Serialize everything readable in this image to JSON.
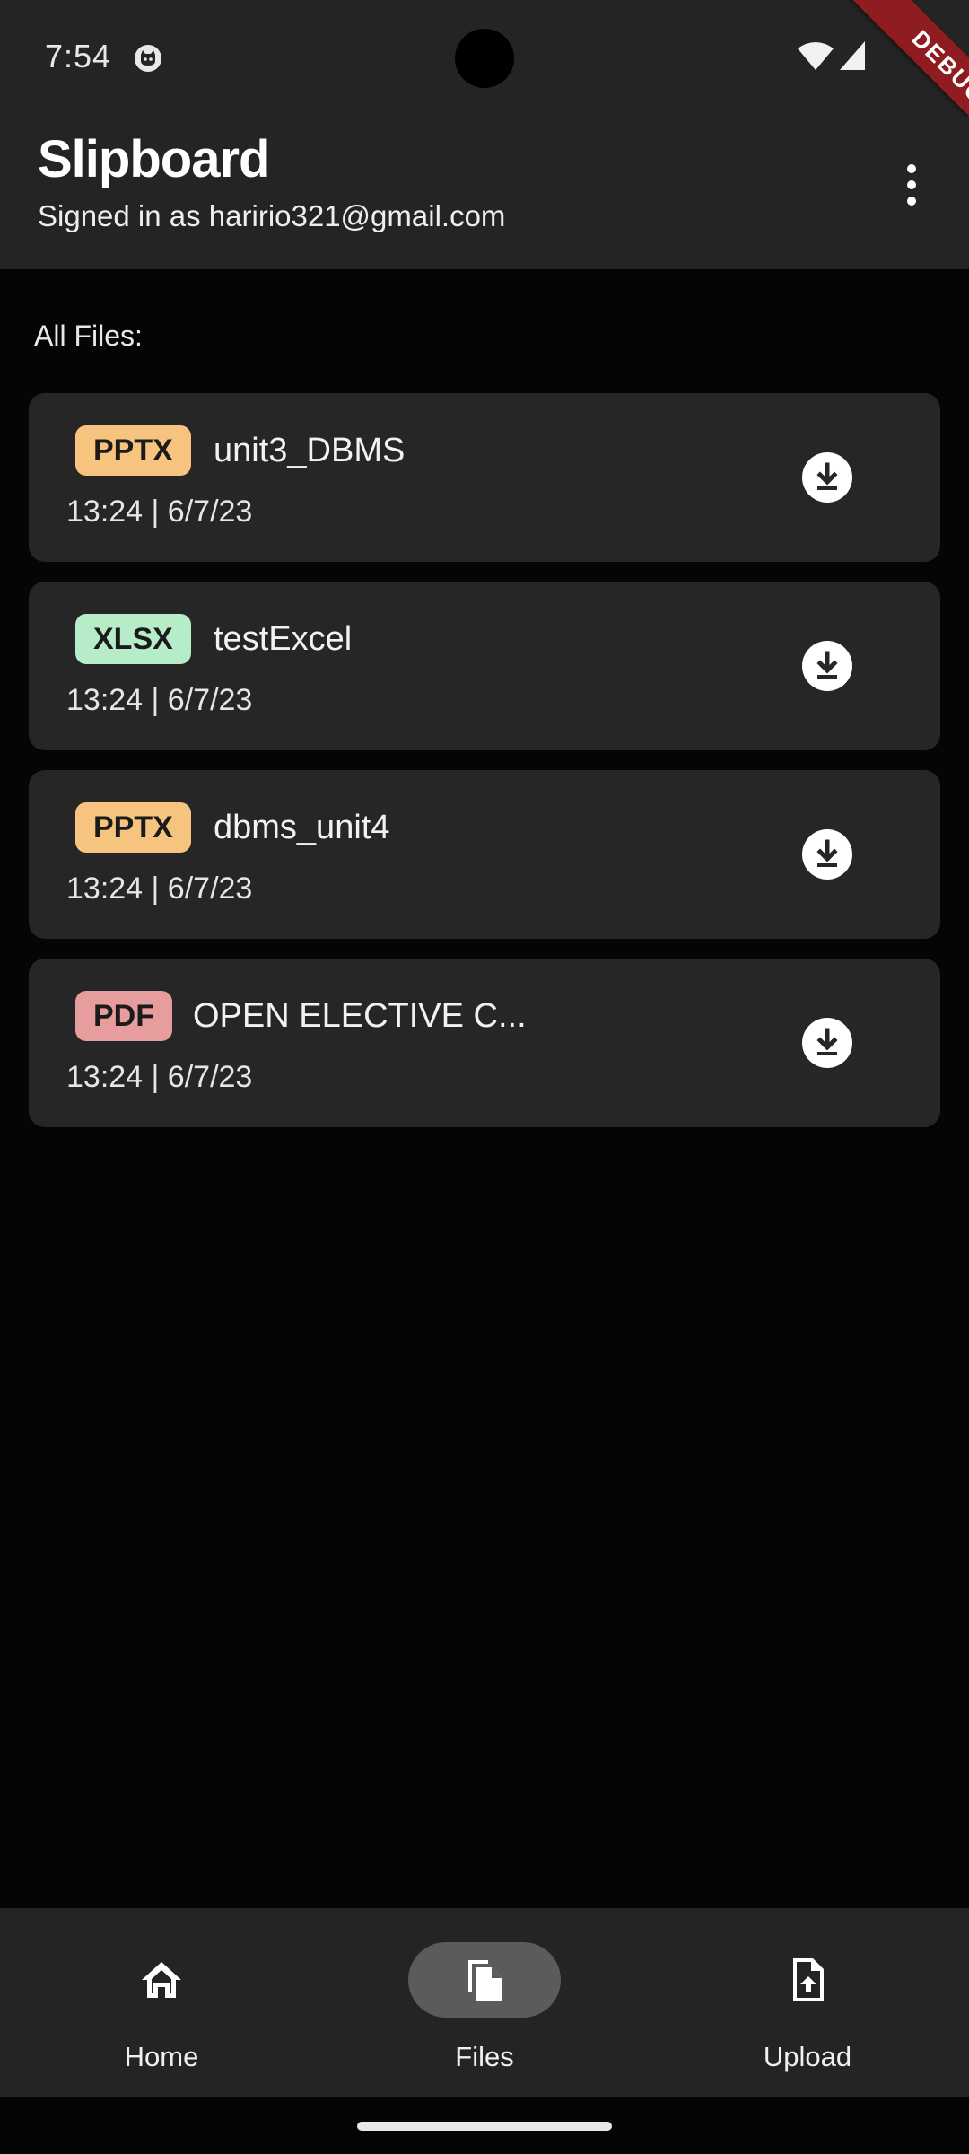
{
  "status_bar": {
    "time": "7:54",
    "debug_label": "DEBUG"
  },
  "app_bar": {
    "title": "Slipboard",
    "subtitle": "Signed in as haririo321@gmail.com"
  },
  "section_label": "All Files:",
  "files": [
    {
      "type": "PPTX",
      "name": "unit3_DBMS",
      "meta": "13:24 | 6/7/23",
      "badge_color": "#f7c47f"
    },
    {
      "type": "XLSX",
      "name": "testExcel",
      "meta": "13:24 | 6/7/23",
      "badge_color": "#b6edc8"
    },
    {
      "type": "PPTX",
      "name": "dbms_unit4",
      "meta": "13:24 | 6/7/23",
      "badge_color": "#f7c47f"
    },
    {
      "type": "PDF",
      "name": "OPEN ELECTIVE C...",
      "meta": "13:24 | 6/7/23",
      "badge_color": "#e79c9e"
    }
  ],
  "bottom_nav": {
    "items": [
      {
        "label": "Home",
        "icon": "home-icon",
        "active": false
      },
      {
        "label": "Files",
        "icon": "files-icon",
        "active": true
      },
      {
        "label": "Upload",
        "icon": "upload-file-icon",
        "active": false
      }
    ]
  },
  "colors": {
    "background": "#050505",
    "surface": "#242424",
    "card": "#262626",
    "debug_banner": "#8e1c20",
    "active_pill": "#5b5b5b"
  }
}
